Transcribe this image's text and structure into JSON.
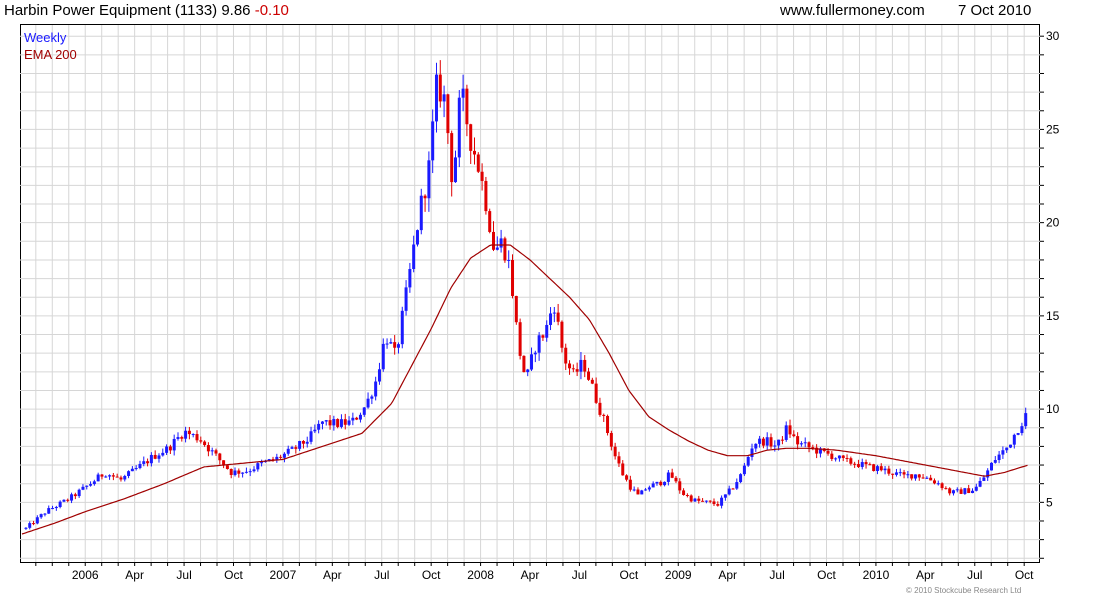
{
  "header": {
    "title": "Harbin Power Equipment (1133) 9.86",
    "change": "-0.10",
    "site": "www.fullermoney.com",
    "date": "7 Oct 2010"
  },
  "footer": {
    "copyright": "© 2010 Stockcube Research Ltd"
  },
  "colors": {
    "up": "#1a1aff",
    "down": "#e00000",
    "ema": "#a00000",
    "grid": "#d6d6d6"
  },
  "chart_data": {
    "type": "line",
    "legend": [
      "Weekly",
      "EMA 200"
    ],
    "legend_placement": "top-left",
    "grid": true,
    "ylim": [
      1.8,
      30.6
    ],
    "yticks": [
      5,
      10,
      15,
      20,
      25,
      30
    ],
    "xlim": [
      2005.67,
      2010.83
    ],
    "xticks": [
      {
        "label": "2006",
        "x": 2006.0
      },
      {
        "label": "Apr",
        "x": 2006.25
      },
      {
        "label": "Jul",
        "x": 2006.5
      },
      {
        "label": "Oct",
        "x": 2006.75
      },
      {
        "label": "2007",
        "x": 2007.0
      },
      {
        "label": "Apr",
        "x": 2007.25
      },
      {
        "label": "Jul",
        "x": 2007.5
      },
      {
        "label": "Oct",
        "x": 2007.75
      },
      {
        "label": "2008",
        "x": 2008.0
      },
      {
        "label": "Apr",
        "x": 2008.25
      },
      {
        "label": "Jul",
        "x": 2008.5
      },
      {
        "label": "Oct",
        "x": 2008.75
      },
      {
        "label": "2009",
        "x": 2009.0
      },
      {
        "label": "Apr",
        "x": 2009.25
      },
      {
        "label": "Jul",
        "x": 2009.5
      },
      {
        "label": "Oct",
        "x": 2009.75
      },
      {
        "label": "2010",
        "x": 2010.0
      },
      {
        "label": "Apr",
        "x": 2010.25
      },
      {
        "label": "Jul",
        "x": 2010.5
      },
      {
        "label": "Oct",
        "x": 2010.75
      }
    ],
    "price_anchors": [
      [
        2005.7,
        3.6
      ],
      [
        2005.8,
        4.5
      ],
      [
        2005.92,
        5.2
      ],
      [
        2006.0,
        5.8
      ],
      [
        2006.1,
        6.6
      ],
      [
        2006.18,
        6.2
      ],
      [
        2006.26,
        6.8
      ],
      [
        2006.35,
        7.5
      ],
      [
        2006.42,
        7.9
      ],
      [
        2006.5,
        8.8
      ],
      [
        2006.58,
        8.4
      ],
      [
        2006.66,
        7.5
      ],
      [
        2006.74,
        6.6
      ],
      [
        2006.82,
        6.7
      ],
      [
        2006.9,
        7.1
      ],
      [
        2006.96,
        7.3
      ],
      [
        2007.05,
        7.8
      ],
      [
        2007.13,
        8.4
      ],
      [
        2007.2,
        9.3
      ],
      [
        2007.27,
        9.2
      ],
      [
        2007.35,
        9.3
      ],
      [
        2007.42,
        10.2
      ],
      [
        2007.47,
        11.5
      ],
      [
        2007.52,
        14.0
      ],
      [
        2007.57,
        12.8
      ],
      [
        2007.63,
        16.5
      ],
      [
        2007.69,
        20.5
      ],
      [
        2007.74,
        23.0
      ],
      [
        2007.78,
        27.5
      ],
      [
        2007.82,
        26.5
      ],
      [
        2007.86,
        22.0
      ],
      [
        2007.9,
        27.0
      ],
      [
        2007.95,
        24.5
      ],
      [
        2007.99,
        23.0
      ],
      [
        2008.03,
        21.0
      ],
      [
        2008.07,
        18.5
      ],
      [
        2008.11,
        19.0
      ],
      [
        2008.15,
        17.5
      ],
      [
        2008.19,
        13.5
      ],
      [
        2008.23,
        11.5
      ],
      [
        2008.28,
        13.5
      ],
      [
        2008.33,
        14.2
      ],
      [
        2008.37,
        15.8
      ],
      [
        2008.42,
        12.8
      ],
      [
        2008.47,
        11.8
      ],
      [
        2008.52,
        12.5
      ],
      [
        2008.57,
        11.0
      ],
      [
        2008.63,
        9.2
      ],
      [
        2008.68,
        7.5
      ],
      [
        2008.72,
        6.5
      ],
      [
        2008.76,
        5.8
      ],
      [
        2008.8,
        5.3
      ],
      [
        2008.84,
        5.8
      ],
      [
        2008.9,
        6.0
      ],
      [
        2008.96,
        6.5
      ],
      [
        2009.02,
        5.5
      ],
      [
        2009.08,
        5.1
      ],
      [
        2009.14,
        5.0
      ],
      [
        2009.2,
        4.9
      ],
      [
        2009.26,
        5.6
      ],
      [
        2009.32,
        6.5
      ],
      [
        2009.38,
        8.2
      ],
      [
        2009.44,
        8.3
      ],
      [
        2009.5,
        8.0
      ],
      [
        2009.55,
        9.0
      ],
      [
        2009.6,
        8.2
      ],
      [
        2009.65,
        8.0
      ],
      [
        2009.72,
        7.7
      ],
      [
        2009.78,
        7.5
      ],
      [
        2009.84,
        7.2
      ],
      [
        2009.9,
        7.1
      ],
      [
        2009.96,
        6.9
      ],
      [
        2010.02,
        6.8
      ],
      [
        2010.08,
        6.6
      ],
      [
        2010.14,
        6.4
      ],
      [
        2010.2,
        6.5
      ],
      [
        2010.26,
        6.3
      ],
      [
        2010.32,
        6.0
      ],
      [
        2010.38,
        5.5
      ],
      [
        2010.44,
        5.6
      ],
      [
        2010.5,
        5.7
      ],
      [
        2010.55,
        6.4
      ],
      [
        2010.6,
        7.3
      ],
      [
        2010.66,
        7.9
      ],
      [
        2010.72,
        9.0
      ],
      [
        2010.77,
        9.86
      ]
    ],
    "ema_anchors": [
      [
        2005.68,
        3.3
      ],
      [
        2005.85,
        3.9
      ],
      [
        2006.0,
        4.5
      ],
      [
        2006.2,
        5.2
      ],
      [
        2006.4,
        6.0
      ],
      [
        2006.6,
        6.9
      ],
      [
        2006.8,
        7.1
      ],
      [
        2007.0,
        7.3
      ],
      [
        2007.2,
        8.0
      ],
      [
        2007.4,
        8.7
      ],
      [
        2007.55,
        10.3
      ],
      [
        2007.65,
        12.3
      ],
      [
        2007.75,
        14.3
      ],
      [
        2007.85,
        16.5
      ],
      [
        2007.95,
        18.1
      ],
      [
        2008.05,
        18.8
      ],
      [
        2008.15,
        18.8
      ],
      [
        2008.25,
        18.0
      ],
      [
        2008.35,
        17.0
      ],
      [
        2008.45,
        16.0
      ],
      [
        2008.55,
        14.8
      ],
      [
        2008.65,
        13.0
      ],
      [
        2008.75,
        11.0
      ],
      [
        2008.85,
        9.6
      ],
      [
        2008.95,
        8.9
      ],
      [
        2009.05,
        8.3
      ],
      [
        2009.15,
        7.8
      ],
      [
        2009.25,
        7.5
      ],
      [
        2009.35,
        7.5
      ],
      [
        2009.45,
        7.8
      ],
      [
        2009.55,
        7.9
      ],
      [
        2009.65,
        7.9
      ],
      [
        2009.8,
        7.8
      ],
      [
        2010.0,
        7.5
      ],
      [
        2010.2,
        7.1
      ],
      [
        2010.4,
        6.7
      ],
      [
        2010.55,
        6.4
      ],
      [
        2010.65,
        6.6
      ],
      [
        2010.77,
        7.0
      ]
    ]
  }
}
